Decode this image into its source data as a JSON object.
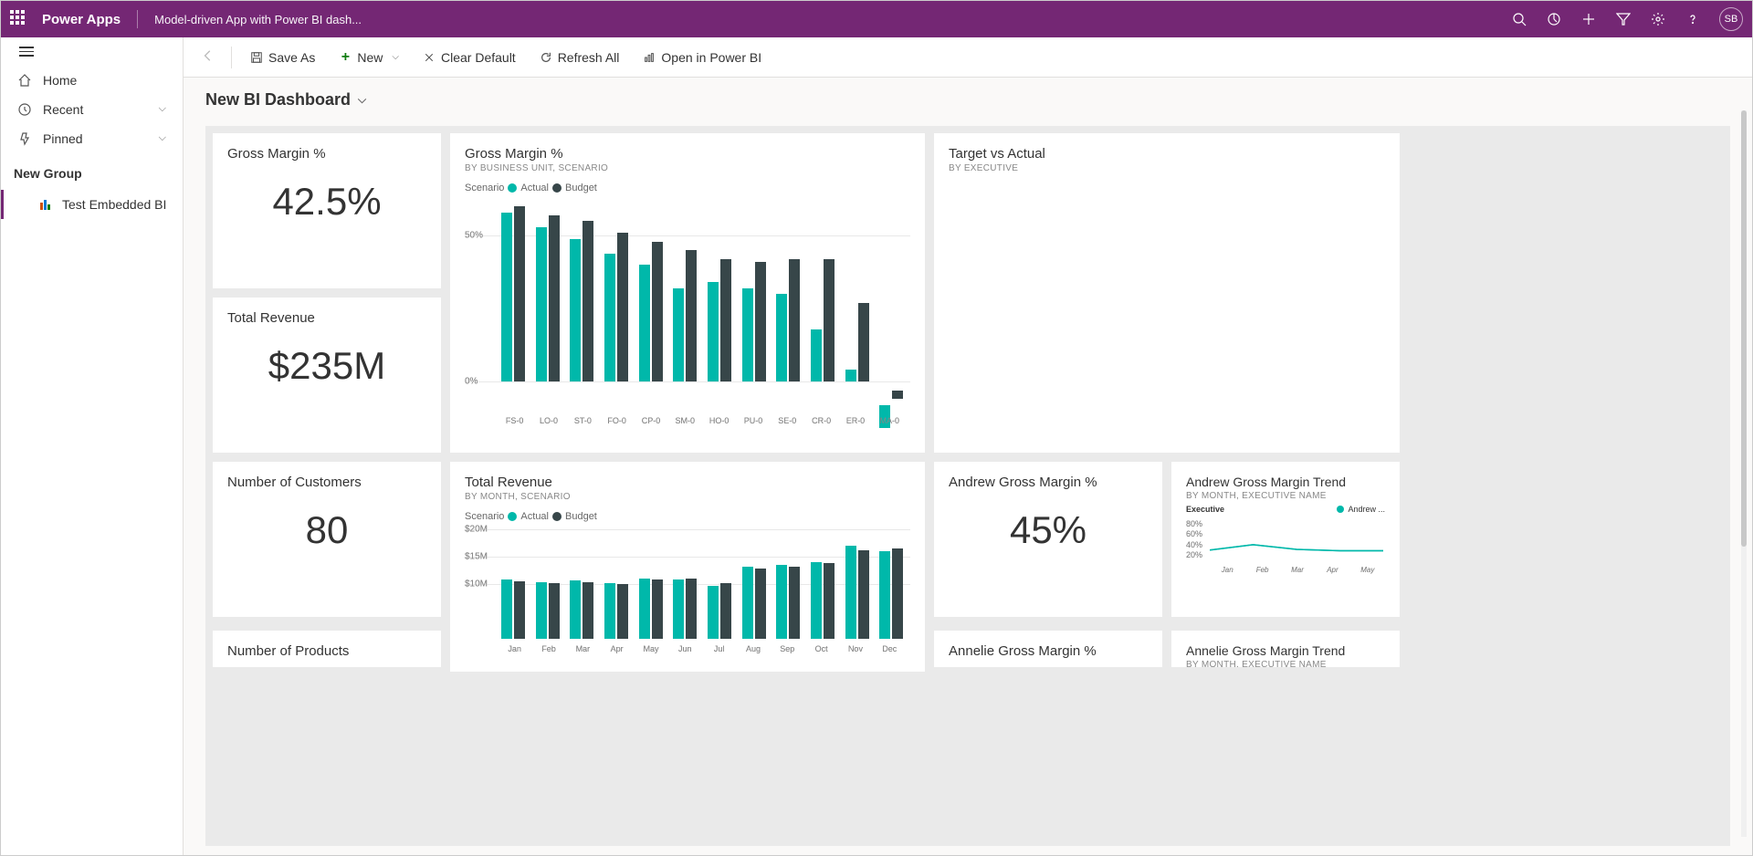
{
  "header": {
    "brand": "Power Apps",
    "subtitle": "Model-driven App with Power BI dash...",
    "avatar": "SB"
  },
  "sidebar": {
    "items": [
      {
        "label": "Home"
      },
      {
        "label": "Recent"
      },
      {
        "label": "Pinned"
      }
    ],
    "group_header": "New Group",
    "group_items": [
      {
        "label": "Test Embedded BI"
      }
    ]
  },
  "toolbar": {
    "save_as": "Save As",
    "new": "New",
    "clear_default": "Clear Default",
    "refresh_all": "Refresh All",
    "open_powerbi": "Open in Power BI"
  },
  "page": {
    "title": "New BI Dashboard"
  },
  "cards": {
    "gross_margin": {
      "title": "Gross Margin %",
      "value": "42.5%"
    },
    "total_revenue": {
      "title": "Total Revenue",
      "value": "$235M"
    },
    "num_customers": {
      "title": "Number of Customers",
      "value": "80"
    },
    "num_products": {
      "title": "Number of Products"
    },
    "target_actual": {
      "title": "Target vs Actual",
      "sub": "BY EXECUTIVE"
    },
    "gm_chart": {
      "title": "Gross Margin %",
      "sub": "BY BUSINESS UNIT, SCENARIO",
      "legend_label": "Scenario",
      "series1": "Actual",
      "series2": "Budget"
    },
    "rev_chart": {
      "title": "Total Revenue",
      "sub": "BY MONTH, SCENARIO",
      "legend_label": "Scenario",
      "series1": "Actual",
      "series2": "Budget"
    },
    "andrew": {
      "title": "Andrew Gross Margin %",
      "value": "45%"
    },
    "andrew_trend": {
      "title": "Andrew Gross Margin Trend",
      "sub": "BY MONTH, EXECUTIVE NAME",
      "legend_label": "Executive",
      "series1": "Andrew ..."
    },
    "annelie": {
      "title": "Annelie Gross Margin %"
    },
    "annelie_trend": {
      "title": "Annelie Gross Margin Trend",
      "sub": "BY MONTH, EXECUTIVE NAME"
    }
  },
  "chart_data": [
    {
      "id": "gross_margin_bar",
      "type": "bar",
      "title": "Gross Margin % by Business Unit, Scenario",
      "ylabel": "%",
      "ylim": [
        -10,
        62
      ],
      "ticks": [
        0,
        50
      ],
      "categories": [
        "FS-0",
        "LO-0",
        "ST-0",
        "FO-0",
        "CP-0",
        "SM-0",
        "HO-0",
        "PU-0",
        "SE-0",
        "CR-0",
        "ER-0",
        "MA-0"
      ],
      "series": [
        {
          "name": "Actual",
          "color": "#00b8aa",
          "values": [
            58,
            53,
            49,
            44,
            40,
            32,
            34,
            32,
            30,
            18,
            4,
            -8
          ]
        },
        {
          "name": "Budget",
          "color": "#374649",
          "values": [
            60,
            57,
            55,
            51,
            48,
            45,
            42,
            41,
            42,
            42,
            27,
            -3
          ]
        }
      ]
    },
    {
      "id": "total_revenue_bar",
      "type": "bar",
      "title": "Total Revenue by Month, Scenario",
      "ylabel": "$M",
      "ylim": [
        0,
        20
      ],
      "ticks": [
        10,
        15,
        20
      ],
      "tick_labels": [
        "$10M",
        "$15M",
        "$20M"
      ],
      "categories": [
        "Jan",
        "Feb",
        "Mar",
        "Apr",
        "May",
        "Jun",
        "Jul",
        "Aug",
        "Sep",
        "Oct",
        "Nov",
        "Dec"
      ],
      "series": [
        {
          "name": "Actual",
          "color": "#00b8aa",
          "values": [
            10.8,
            10.3,
            10.6,
            10.2,
            11.0,
            10.8,
            9.7,
            13.2,
            13.5,
            14.0,
            17.0,
            16.0
          ]
        },
        {
          "name": "Budget",
          "color": "#374649",
          "values": [
            10.5,
            10.2,
            10.3,
            10.0,
            10.8,
            11.0,
            10.2,
            12.8,
            13.2,
            13.8,
            16.2,
            16.5
          ]
        }
      ]
    },
    {
      "id": "andrew_trend_line",
      "type": "line",
      "title": "Andrew Gross Margin Trend",
      "ylabel": "%",
      "ylim": [
        20,
        80
      ],
      "ticks": [
        20,
        40,
        60,
        80
      ],
      "categories": [
        "Jan",
        "Feb",
        "Mar",
        "Apr",
        "May"
      ],
      "series": [
        {
          "name": "Andrew",
          "color": "#00b8aa",
          "values": [
            34,
            42,
            35,
            33,
            33
          ]
        }
      ]
    }
  ]
}
